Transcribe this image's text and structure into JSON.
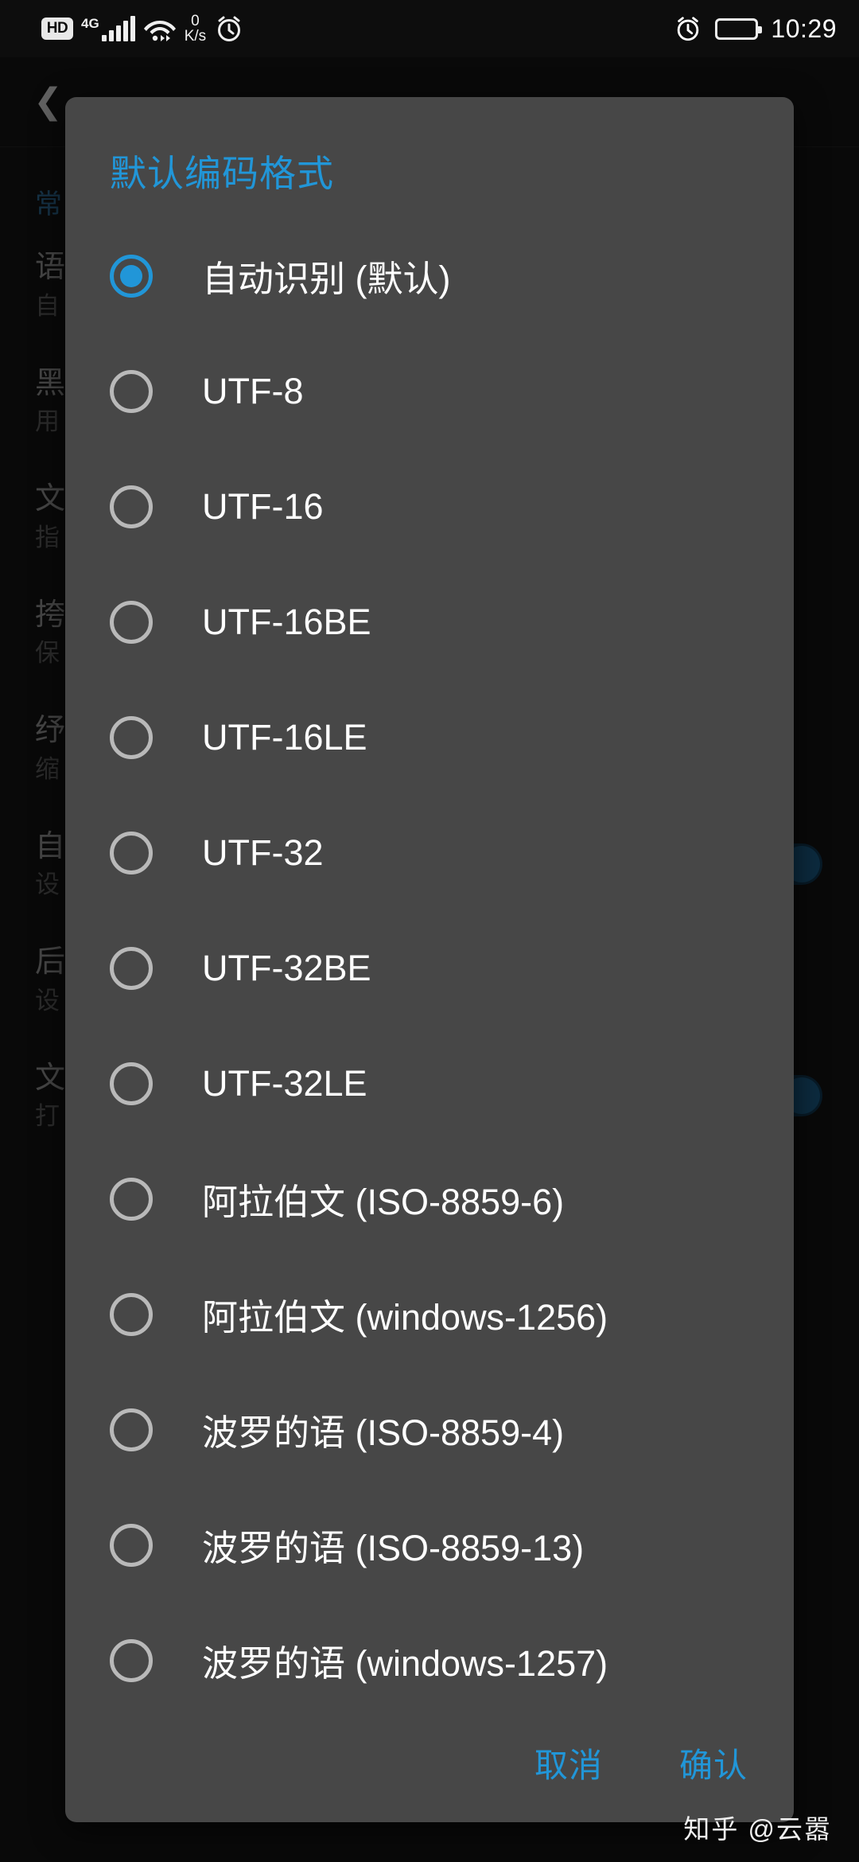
{
  "statusbar": {
    "hd_label": "HD",
    "network_type": "4G",
    "net_speed_value": "0",
    "net_speed_unit": "K/s",
    "alarm_icon": "alarm-clock-icon",
    "wifi_icon": "wifi-icon",
    "battery_icon": "battery-icon",
    "time": "10:29"
  },
  "background_page": {
    "back_icon": "back-arrow-icon",
    "section_title": "常",
    "rows": [
      {
        "line1": "语",
        "line2": "自",
        "toggle": false
      },
      {
        "line1": "黑",
        "line2": "用",
        "toggle": false
      },
      {
        "line1": "文",
        "line2": "指",
        "toggle": false
      },
      {
        "line1": "挎",
        "line2": "保",
        "toggle": false
      },
      {
        "line1": "纾",
        "line2": "缩",
        "toggle": false
      },
      {
        "line1": "自",
        "line2": "设",
        "toggle": true
      },
      {
        "line1": "后",
        "line2": "设",
        "toggle": false
      },
      {
        "line1": "文",
        "line2": "打",
        "toggle": true
      }
    ]
  },
  "dialog": {
    "title": "默认编码格式",
    "selected_index": 0,
    "options": [
      {
        "label": "自动识别 (默认)",
        "checked": true
      },
      {
        "label": "UTF-8",
        "checked": false
      },
      {
        "label": "UTF-16",
        "checked": false
      },
      {
        "label": "UTF-16BE",
        "checked": false
      },
      {
        "label": "UTF-16LE",
        "checked": false
      },
      {
        "label": "UTF-32",
        "checked": false
      },
      {
        "label": "UTF-32BE",
        "checked": false
      },
      {
        "label": "UTF-32LE",
        "checked": false
      },
      {
        "label": "阿拉伯文 (ISO-8859-6)",
        "checked": false
      },
      {
        "label": "阿拉伯文 (windows-1256)",
        "checked": false
      },
      {
        "label": "波罗的语 (ISO-8859-4)",
        "checked": false
      },
      {
        "label": "波罗的语 (ISO-8859-13)",
        "checked": false
      },
      {
        "label": "波罗的语 (windows-1257)",
        "checked": false
      }
    ],
    "cancel_label": "取消",
    "confirm_label": "确认"
  },
  "watermark": "知乎 @云嚣",
  "colors": {
    "accent": "#2196d8",
    "dialog_bg": "#474747",
    "page_bg": "#141414",
    "radio_unchecked": "#b9b9b9",
    "option_text": "#ffffff"
  }
}
